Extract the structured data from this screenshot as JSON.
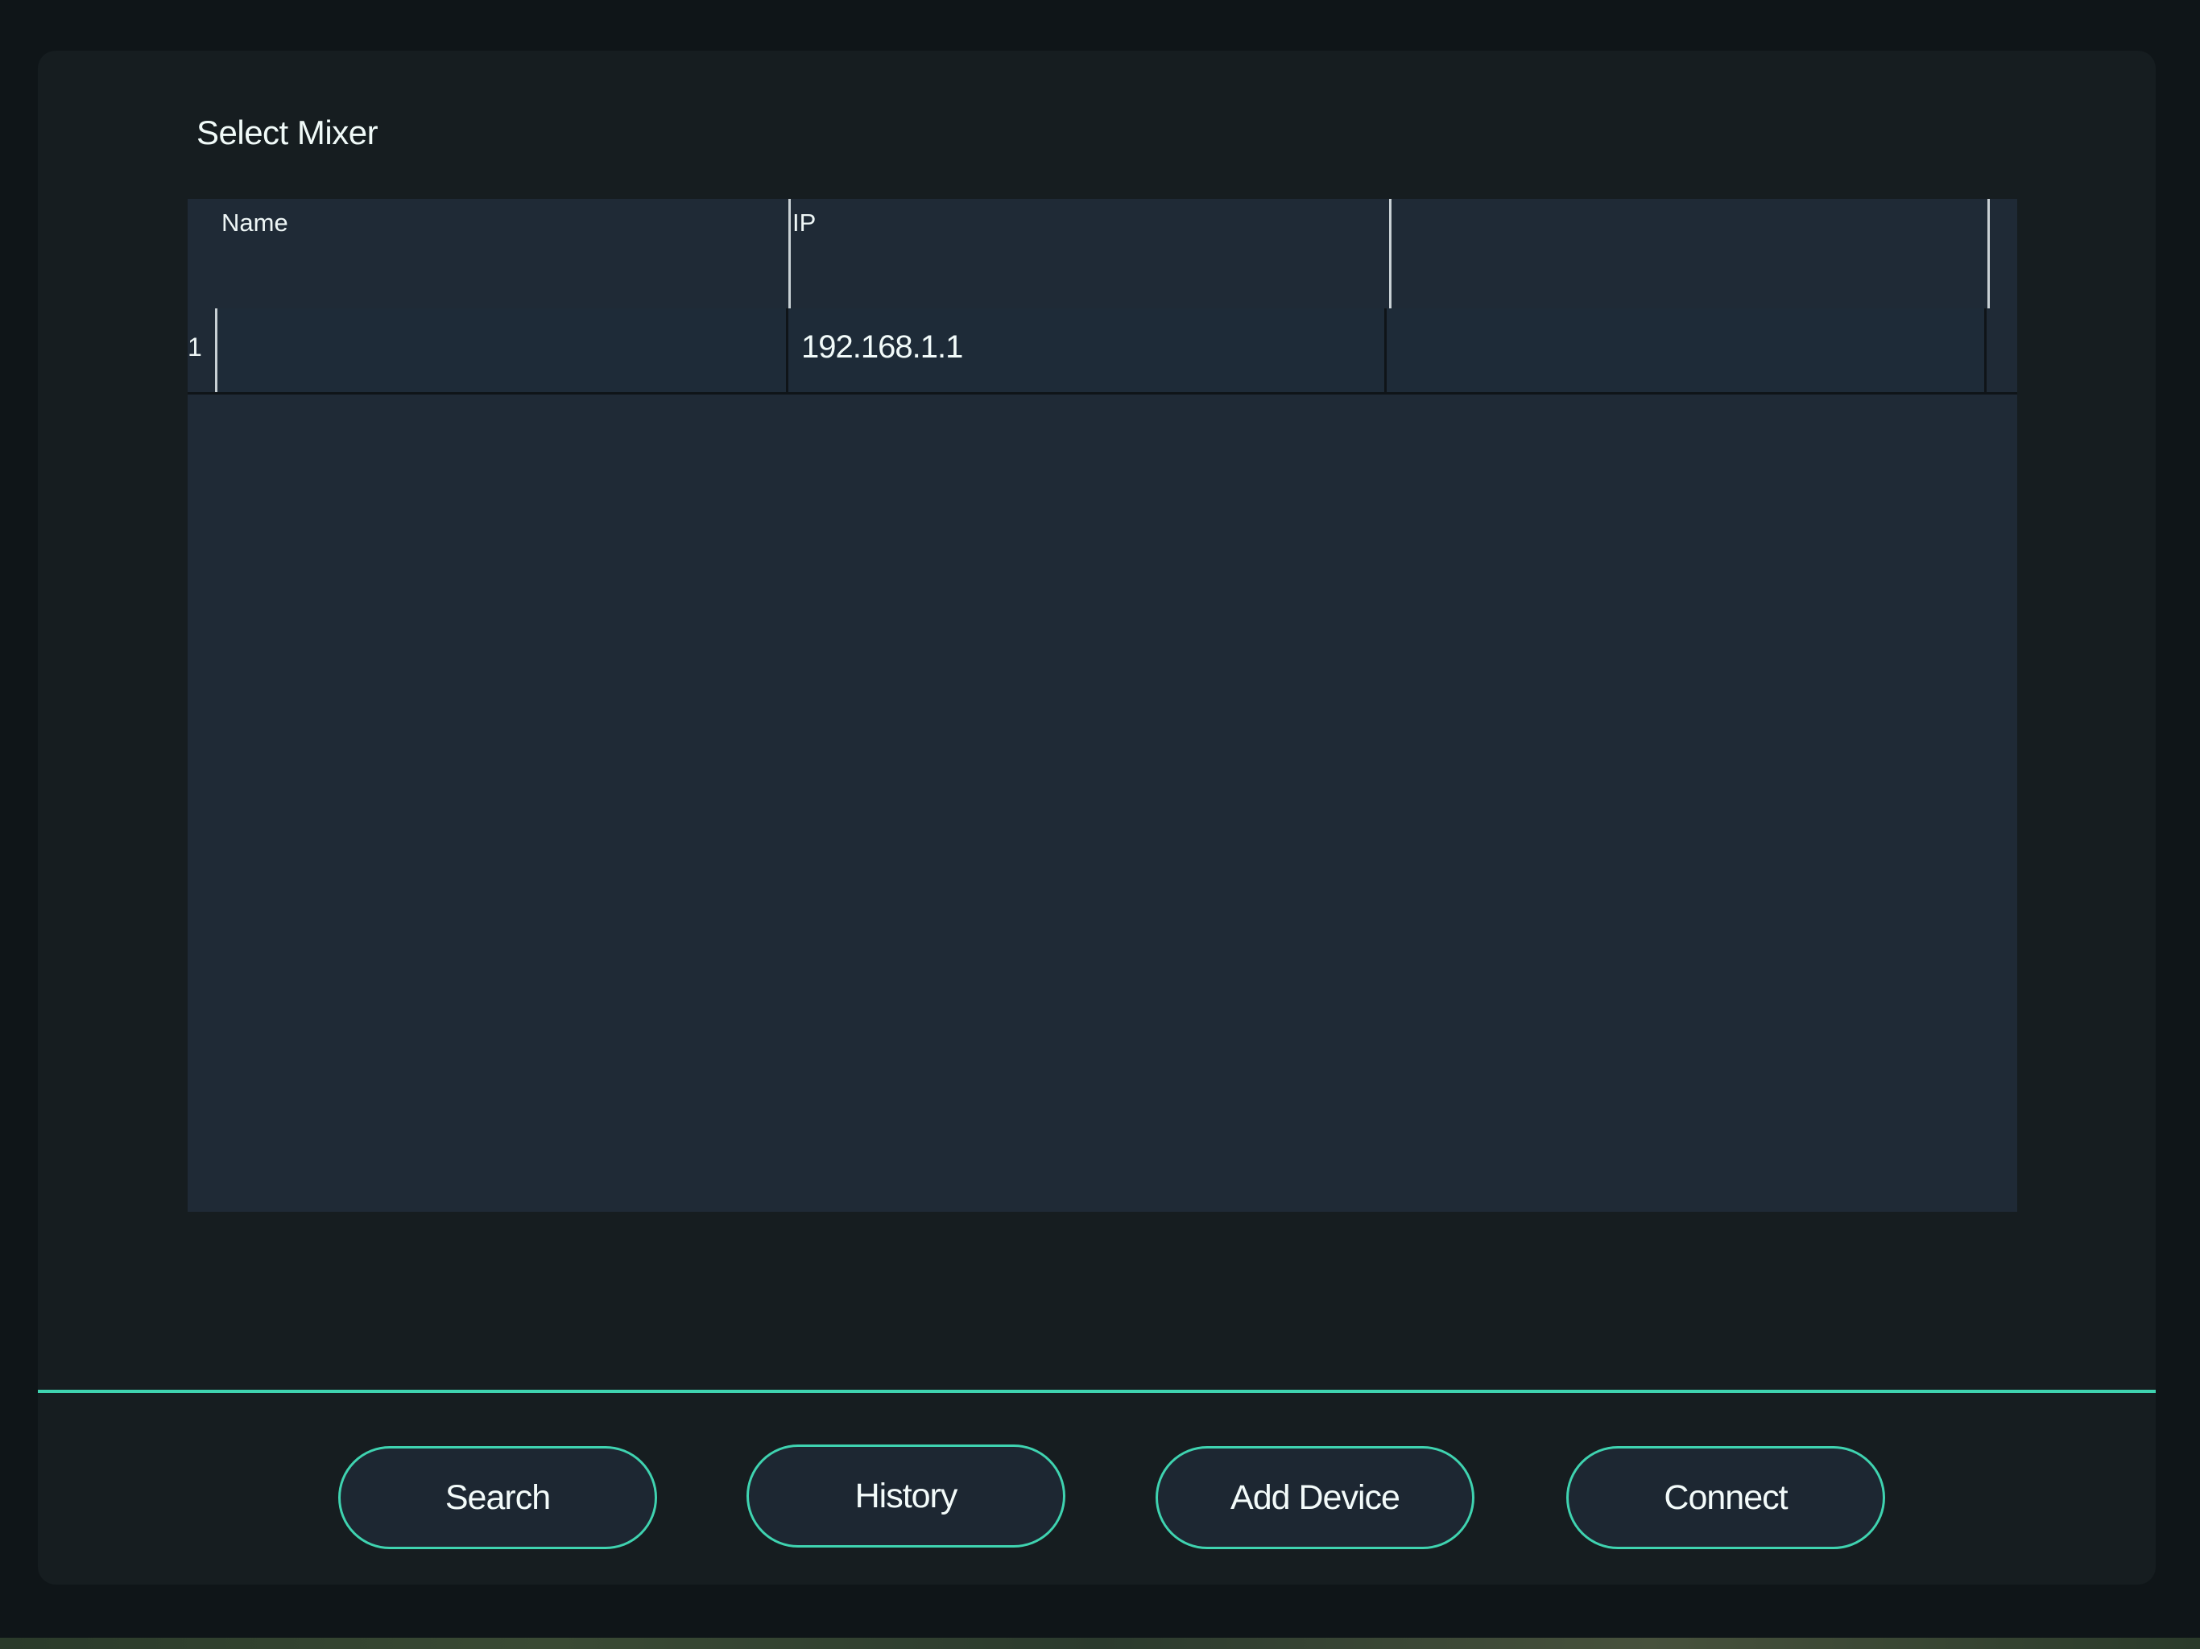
{
  "dialog": {
    "title": "Select Mixer"
  },
  "table": {
    "columns": [
      "Name",
      "IP",
      ""
    ],
    "rows": [
      {
        "index": "1",
        "name": "",
        "ip": "192.168.1.1",
        "extra": ""
      }
    ]
  },
  "buttons": {
    "search": "Search",
    "history": "History",
    "add_device": "Add Device",
    "connect": "Connect"
  },
  "colors": {
    "accent": "#3fd3b0",
    "dialog_bg": "#161d20",
    "table_bg": "#1f2a36",
    "button_bg": "#1d2732"
  }
}
